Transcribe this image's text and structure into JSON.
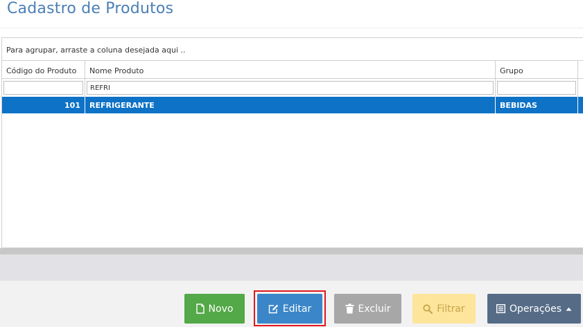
{
  "page": {
    "title": "Cadastro de Produtos"
  },
  "grid": {
    "group_panel_text": "Para agrupar, arraste a coluna desejada aqui ..",
    "columns": [
      "Código do Produto",
      "Nome Produto",
      "Grupo",
      ""
    ],
    "filters": {
      "codigo": "",
      "nome": "REFRI",
      "grupo": ""
    },
    "rows": [
      {
        "codigo": "101",
        "nome": "REFRIGERANTE",
        "grupo": "BEBIDAS"
      }
    ]
  },
  "actions": {
    "novo_label": "Novo",
    "editar_label": "Editar",
    "excluir_label": "Excluir",
    "filtrar_label": "Filtrar",
    "operacoes_label": "Operações"
  },
  "icons": {
    "novo": "file-icon",
    "editar": "edit-icon",
    "excluir": "trash-icon",
    "filtrar": "search-icon",
    "operacoes": "list-icon"
  },
  "colors": {
    "selected_row": "#0e72c6",
    "novo": "#53a847",
    "editar": "#3a86c8",
    "excluir": "#a7a7a7",
    "filtrar": "#fde59b",
    "operacoes": "#566c86",
    "highlight": "#e0171e"
  }
}
